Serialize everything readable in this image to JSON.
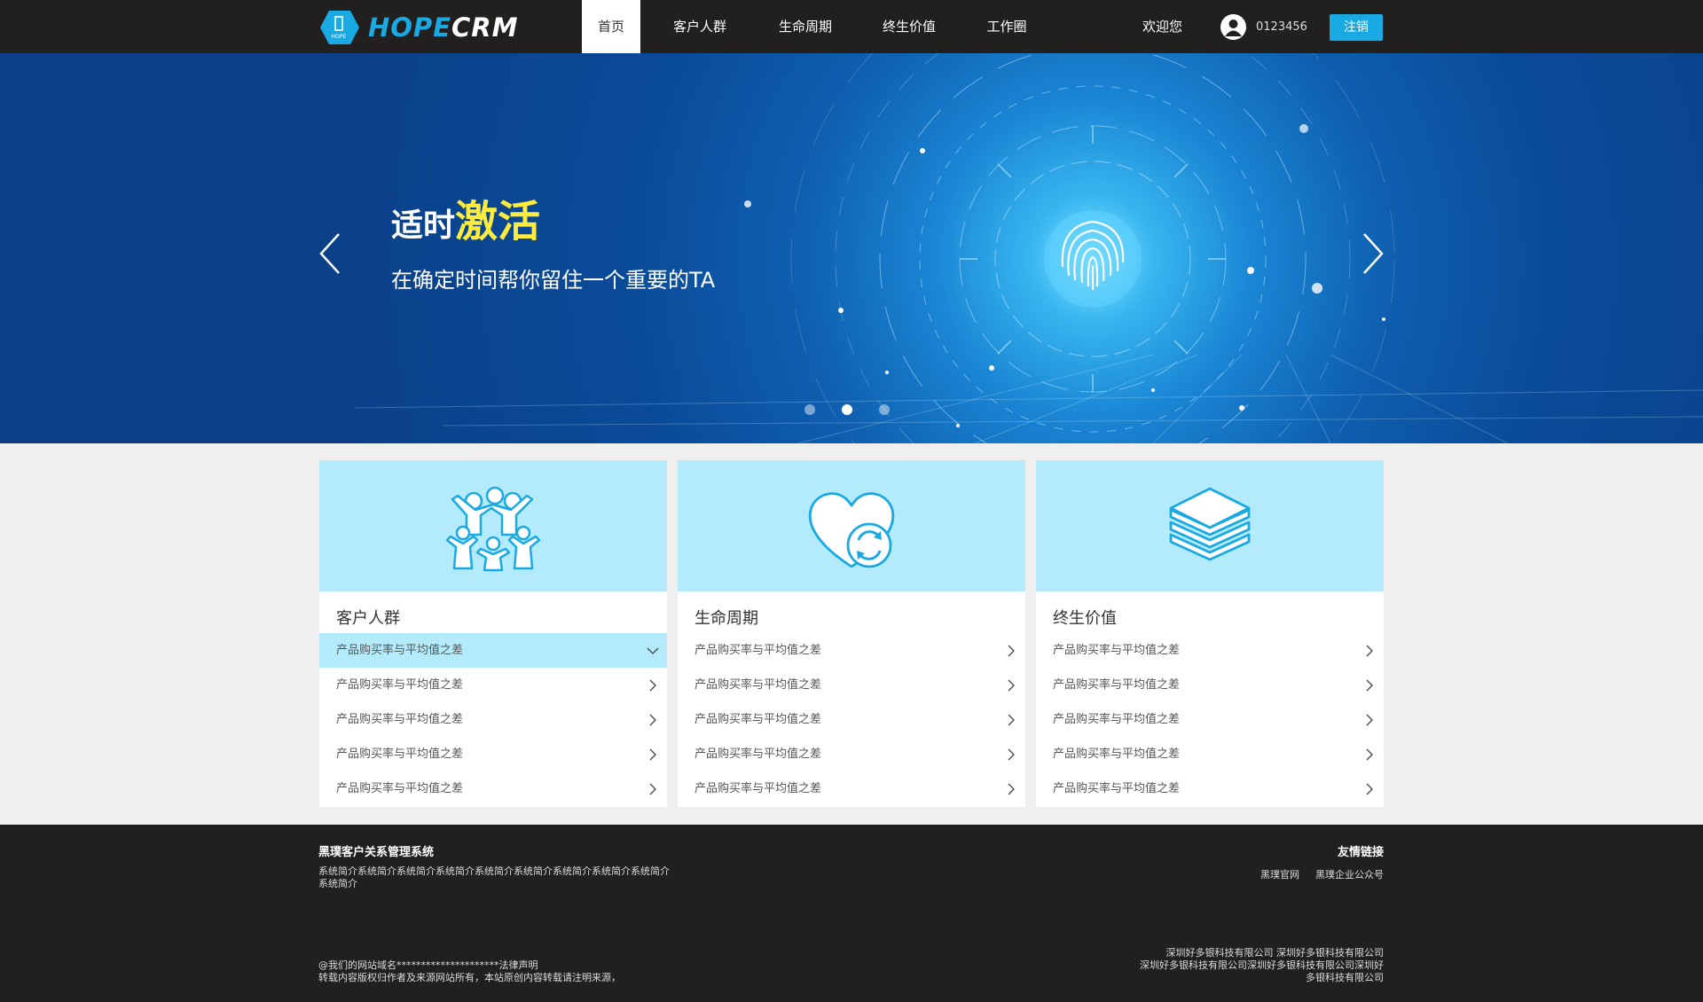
{
  "header": {
    "logo_hope": "HOPE",
    "logo_crm": "CRM",
    "logo_badge": "HOPE",
    "nav": [
      {
        "label": "首页",
        "active": true
      },
      {
        "label": "客户人群",
        "active": false
      },
      {
        "label": "生命周期",
        "active": false
      },
      {
        "label": "终生价值",
        "active": false
      },
      {
        "label": "工作圈",
        "active": false
      }
    ],
    "welcome": "欢迎您",
    "username": "0123456",
    "logout": "注销"
  },
  "banner": {
    "title_prefix": "适时",
    "title_highlight": "激活",
    "subtitle": "在确定时间帮你留住一个重要的TA",
    "slides": 3,
    "active_slide": 2
  },
  "cards": [
    {
      "title": "客户人群",
      "icon": "people-group-icon",
      "items": [
        "产品购买率与平均值之差",
        "产品购买率与平均值之差",
        "产品购买率与平均值之差",
        "产品购买率与平均值之差",
        "产品购买率与平均值之差"
      ],
      "active_index": 0
    },
    {
      "title": "生命周期",
      "icon": "heart-refresh-icon",
      "items": [
        "产品购买率与平均值之差",
        "产品购买率与平均值之差",
        "产品购买率与平均值之差",
        "产品购买率与平均值之差",
        "产品购买率与平均值之差"
      ],
      "active_index": -1
    },
    {
      "title": "终生价值",
      "icon": "layers-icon",
      "items": [
        "产品购买率与平均值之差",
        "产品购买率与平均值之差",
        "产品购买率与平均值之差",
        "产品购买率与平均值之差",
        "产品购买率与平均值之差"
      ],
      "active_index": -1
    }
  ],
  "footer": {
    "title": "黑璞客户关系管理系统",
    "description": "系统简介系统简介系统简介系统简介系统简介系统简介系统简介系统简介系统简介系统简介",
    "legal_line1": "@我们的网站域名*********************法律声明",
    "legal_line2": "转载内容版权归作者及来源网站所有，本站原创内容转载请注明来源，",
    "links_title": "友情链接",
    "links": [
      "黑璞官网",
      "黑璞企业公众号"
    ],
    "company_line1": "深圳好多银科技有限公司 深圳好多银科技有限公司",
    "company_line2": "深圳好多银科技有限公司深圳好多银科技有限公司深圳好",
    "company_line3": "多银科技有限公司"
  },
  "colors": {
    "accent": "#19a9e3",
    "card_top": "#b4ebfb",
    "dark_bar": "#221f1f",
    "banner_highlight": "#ffeb3b"
  }
}
